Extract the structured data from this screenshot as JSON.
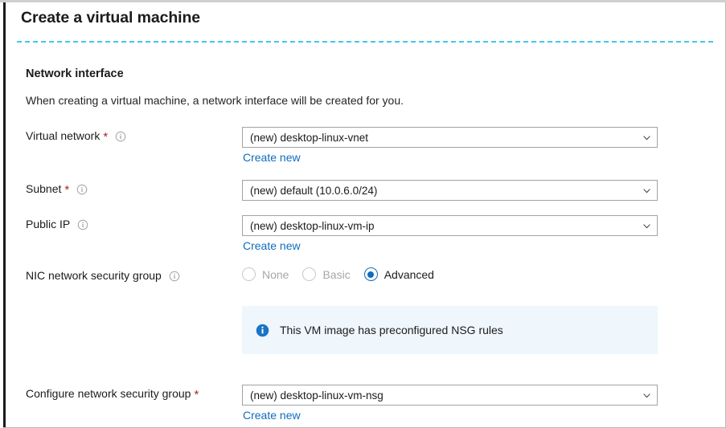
{
  "blade": {
    "title": "Create a virtual machine"
  },
  "section": {
    "heading": "Network interface",
    "description": "When creating a virtual machine, a network interface will be created for you."
  },
  "fields": {
    "virtual_network": {
      "label": "Virtual network",
      "required_marker": "*",
      "info_icon": "info-circle-icon",
      "value": "(new) desktop-linux-vnet",
      "chevron_icon": "chevron-down-icon",
      "create_new_label": "Create new"
    },
    "subnet": {
      "label": "Subnet",
      "required_marker": "*",
      "info_icon": "info-circle-icon",
      "value": "(new) default (10.0.6.0/24)",
      "chevron_icon": "chevron-down-icon"
    },
    "public_ip": {
      "label": "Public IP",
      "info_icon": "info-circle-icon",
      "value": "(new) desktop-linux-vm-ip",
      "chevron_icon": "chevron-down-icon",
      "create_new_label": "Create new"
    },
    "nic_network_security_group": {
      "label": "NIC network security group",
      "info_icon": "info-circle-icon",
      "options": [
        {
          "label": "None",
          "selected": false,
          "disabled": true
        },
        {
          "label": "Basic",
          "selected": false,
          "disabled": true
        },
        {
          "label": "Advanced",
          "selected": true,
          "disabled": false
        }
      ],
      "selected_value": "Advanced"
    },
    "configure_network_security_group": {
      "label": "Configure network security group",
      "required_marker": "*",
      "value": "(new) desktop-linux-vm-nsg",
      "chevron_icon": "chevron-down-icon",
      "create_new_label": "Create new"
    }
  },
  "banner": {
    "icon": "info-filled-icon",
    "text": "This VM image has preconfigured NSG rules",
    "background": "#eff6fc",
    "icon_color": "#0f6cbd"
  },
  "colors": {
    "link": "#0f6cbd",
    "required_star": "#a4262c",
    "accent": "#0f6cbd",
    "divider_dashed": "#3ec8f5",
    "text": "#1b1b1b"
  }
}
